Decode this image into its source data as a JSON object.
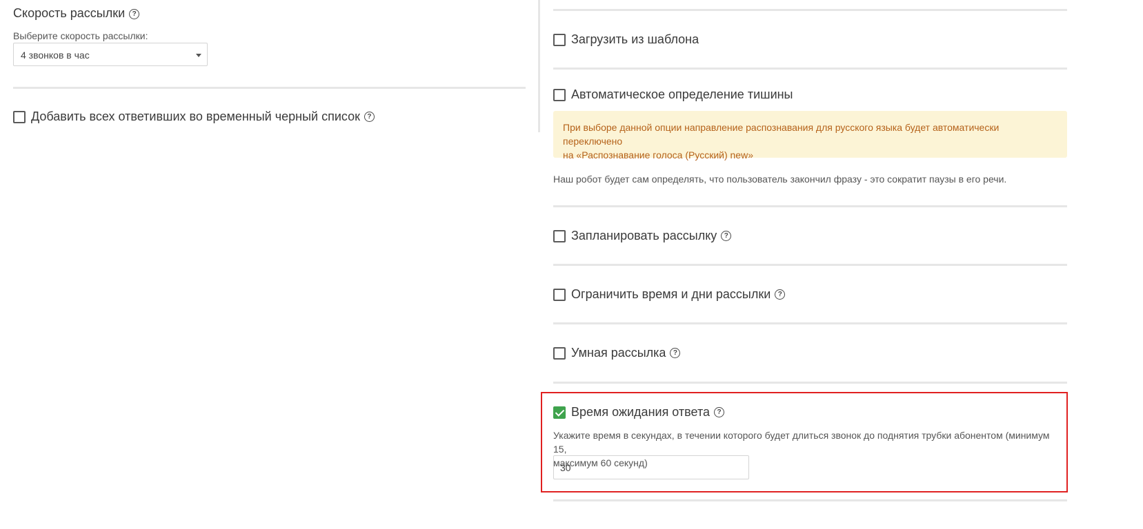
{
  "left": {
    "speed_title": "Скорость рассылки",
    "speed_select_label": "Выберите скорость рассылки:",
    "speed_select_value": "4 звонков в час",
    "blacklist_label": "Добавить всех ответивших во временный черный список"
  },
  "right": {
    "load_template_label": "Загрузить из шаблона",
    "silence_label": "Автоматическое определение тишины",
    "silence_warning_line1": "При выборе данной опции направление распознавания для русского языка будет автоматически переключено",
    "silence_warning_line2": "на «Распознавание голоса (Русский) new»",
    "silence_description": "Наш робот будет сам определять, что пользователь закончил фразу - это сократит паузы в его речи.",
    "schedule_label": "Запланировать рассылку",
    "limit_time_label": "Ограничить время и дни рассылки",
    "smart_label": "Умная рассылка",
    "wait_time_label": "Время ожидания ответа",
    "wait_time_description_line1": "Укажите время в секундах, в течении которого будет длиться звонок до поднятия трубки абонентом (минимум 15,",
    "wait_time_description_line2": "максимум 60 секунд)",
    "wait_time_value": "30"
  },
  "icons": {
    "help": "?"
  },
  "colors": {
    "checkbox_checked": "#3fa34d",
    "warning_bg": "#fcf4d6",
    "warning_text": "#b5621a",
    "highlight_border": "#e02020"
  }
}
